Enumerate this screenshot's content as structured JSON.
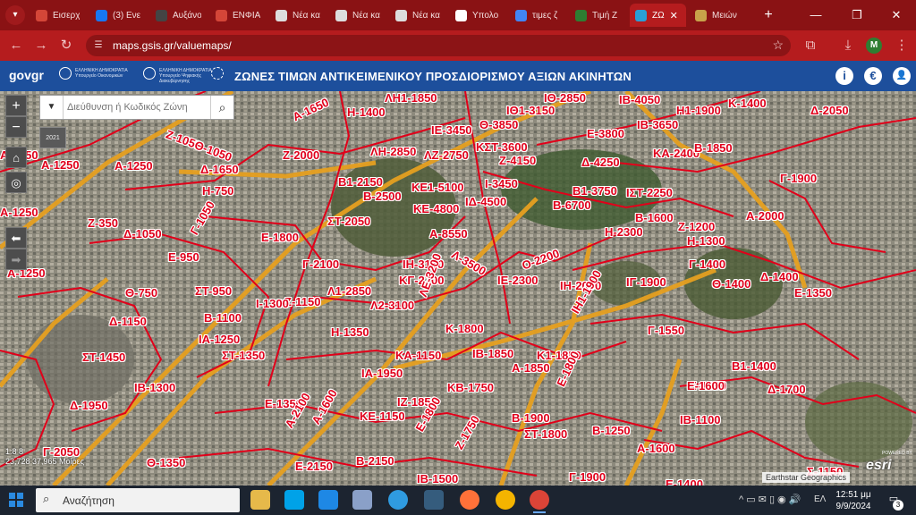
{
  "browser": {
    "tabs": [
      {
        "label": "Εισερχ",
        "favicon_color": "#d44638"
      },
      {
        "label": "(3) Ενε",
        "favicon_color": "#1877f2"
      },
      {
        "label": "Αυξάνο",
        "favicon_color": "#444444"
      },
      {
        "label": "ΕΝΦΙΑ",
        "favicon_color": "#d44638"
      },
      {
        "label": "Νέα κα",
        "favicon_color": "#dddddd"
      },
      {
        "label": "Νέα κα",
        "favicon_color": "#dddddd"
      },
      {
        "label": "Νέα κα",
        "favicon_color": "#dddddd"
      },
      {
        "label": "Υπολο",
        "favicon_color": "#ffffff"
      },
      {
        "label": "τιμες ζ",
        "favicon_color": "#4285f4"
      },
      {
        "label": "Τιμή Ζ",
        "favicon_color": "#2e7d32"
      },
      {
        "label": "ΖΩ",
        "favicon_color": "#2a9fd6",
        "active": true
      },
      {
        "label": "Μειών",
        "favicon_color": "#c8a24a"
      }
    ],
    "url": "maps.gsis.gr/valuemaps/",
    "profile_initial": "M",
    "tab_close": "✕",
    "new_tab": "+",
    "window_controls": {
      "minimize": "—",
      "restore": "❐",
      "close": "✕"
    }
  },
  "app_header": {
    "logo": "govgr",
    "ministry_1": "ΕΛΛΗΝΙΚΗ ΔΗΜΟΚΡΑΤΙΑ Υπουργείο Οικονομικών",
    "ministry_2": "ΕΛΛΗΝΙΚΗ ΔΗΜΟΚΡΑΤΙΑ Υπουργείο Ψηφιακής Διακυβέρνησης",
    "title": "ΖΩΝΕΣ ΤΙΜΩΝ ΑΝΤΙΚΕΙΜΕΝΙΚΟΥ ΠΡΟΣΔΙΟΡΙΣΜΟΥ ΑΞΙΩΝ ΑΚΙΝΗΤΩΝ",
    "info_icon": "i",
    "euro_icon": "€"
  },
  "map": {
    "search": {
      "placeholder": "Διεύθυνση ή Κωδικός Ζώνη"
    },
    "year": "2021",
    "zoom_in": "+",
    "zoom_out": "−",
    "scale": "1:8 8",
    "coordinates": "23,728 37,965 Μοίρες",
    "attribution": "Earthstar Geographics",
    "esri": "esri",
    "esri_powered": "POWERED BY",
    "zones": [
      "ΛΗ1-1850",
      "ΙΘ-2850",
      "Η-1400",
      "ΙΘ1-3150",
      "ΙΒ-4050",
      "Η1-1900",
      "Κ-1400",
      "Δ-2050",
      "Α-1650",
      "Θ-3850",
      "ΙΕ-3450",
      "ΙΒ-3650",
      "Ε-3800",
      "Ζ-1050",
      "Θ-1050",
      "ΚΣΤ-3600",
      "Ζ-2000",
      "ΛΗ-2850",
      "ΛΖ-2750",
      "Ζ-4150",
      "Δ-4250",
      "ΚΑ-2400",
      "Β-1850",
      "Α-1250",
      "Α-1250",
      "Δ-1650",
      "Β1-2150",
      "Ι-3450",
      "Γ-1900",
      "Η-750",
      "ΚΕ1-5100",
      "Β-2500",
      "Β1-3750",
      "ΙΣΤ-2250",
      "ΚΕ-4800",
      "ΙΔ-4500",
      "Β-6700",
      "Α-2000",
      "ΣΤ-2050",
      "Β-1600",
      "Ζ-1200",
      "Ζ-350",
      "Δ-1050",
      "Γ-1050",
      "Ε-1800",
      "Α-8550",
      "Η-2300",
      "Η-1300",
      "Ε-950",
      "Λ-3500",
      "ΙΗ-3150",
      "Γ-2100",
      "Ο-2200",
      "Γ-1400",
      "Α-1250",
      "Δ-1400",
      "ΣΤ-950",
      "ΚΓ-2700",
      "ΙΕ-2300",
      "ΙΗ-2000",
      "ΙΓ-1900",
      "Θ-1400",
      "Ε-1350",
      "Θ-750",
      "Λ1-2850",
      "ΛΕ-3200",
      "Ζ-1150",
      "Ι-1300",
      "Λ2-3100",
      "ΙΗ1-1900",
      "Δ-1150",
      "Β-1100",
      "Η-1350",
      "Κ-1800",
      "Γ-1550",
      "ΙΑ-1250",
      "ΣΤ-1350",
      "ΙΒ-1850",
      "ΣΤ-1450",
      "ΚΑ-1150",
      "Κ1-1850",
      "ΙΑ-1950",
      "Α-1850",
      "Β1-1400",
      "Ε-1350",
      "ΙΒ-1300",
      "ΚΒ-1750",
      "Ε-1800",
      "Ε-1600",
      "Δ-1700",
      "Δ-1950",
      "ΙΖ-1850",
      "Ε-1350",
      "ΚΕ-1150",
      "Β-1900",
      "ΙΒ-1100",
      "Α-2100",
      "Α-1600",
      "Ε-1800",
      "ΣΤ-1800",
      "Β-1250",
      "Γ-2050",
      "Ζ-1750",
      "Α-1600",
      "Θ-1350",
      "Ε-2150",
      "Β-2150",
      "ΙΒ-1500",
      "Γ-1900",
      "Σ-1150",
      "Ε-1400",
      "Α-1250",
      "Α-1250"
    ]
  },
  "taskbar": {
    "search_placeholder": "Αναζήτηση",
    "language": "ΕΛ",
    "time": "12:51 μμ",
    "date": "9/9/2024",
    "notifications": "3"
  }
}
